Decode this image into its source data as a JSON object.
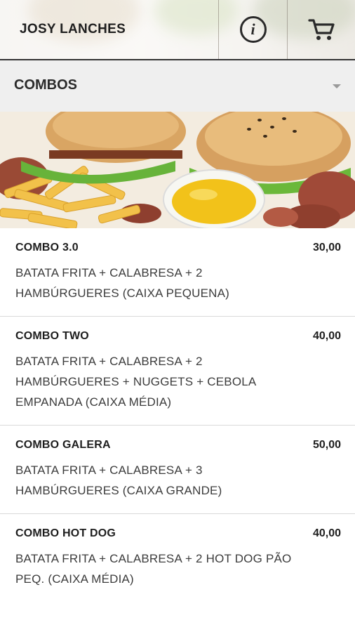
{
  "header": {
    "title": "JOSY LANCHES",
    "info_icon": "info-icon",
    "cart_icon": "cart-icon"
  },
  "category": {
    "selected": "COMBOS",
    "dropdown_icon": "chevron-down-icon"
  },
  "banner": {
    "image": "combo-burgers-fries-photo"
  },
  "products": [
    {
      "name": "COMBO 3.0",
      "price": "30,00",
      "description": "BATATA FRITA + CALABRESA + 2 HAMBÚRGUERES (CAIXA PEQUENA)"
    },
    {
      "name": "COMBO TWO",
      "price": "40,00",
      "description": "BATATA FRITA + CALABRESA + 2 HAMBÚRGUERES + NUGGETS + CEBOLA EMPANADA (CAIXA MÉDIA)"
    },
    {
      "name": "COMBO GALERA",
      "price": "50,00",
      "description": "BATATA FRITA + CALABRESA + 3 HAMBÚRGUERES (CAIXA GRANDE)"
    },
    {
      "name": "COMBO HOT DOG",
      "price": "40,00",
      "description": "BATATA FRITA + CALABRESA + 2 HOT DOG PÃO PEQ. (CAIXA MÉDIA)"
    }
  ],
  "colors": {
    "header_text": "#1f1f1f",
    "category_bg": "#efefef",
    "divider": "#d9d9d9"
  }
}
